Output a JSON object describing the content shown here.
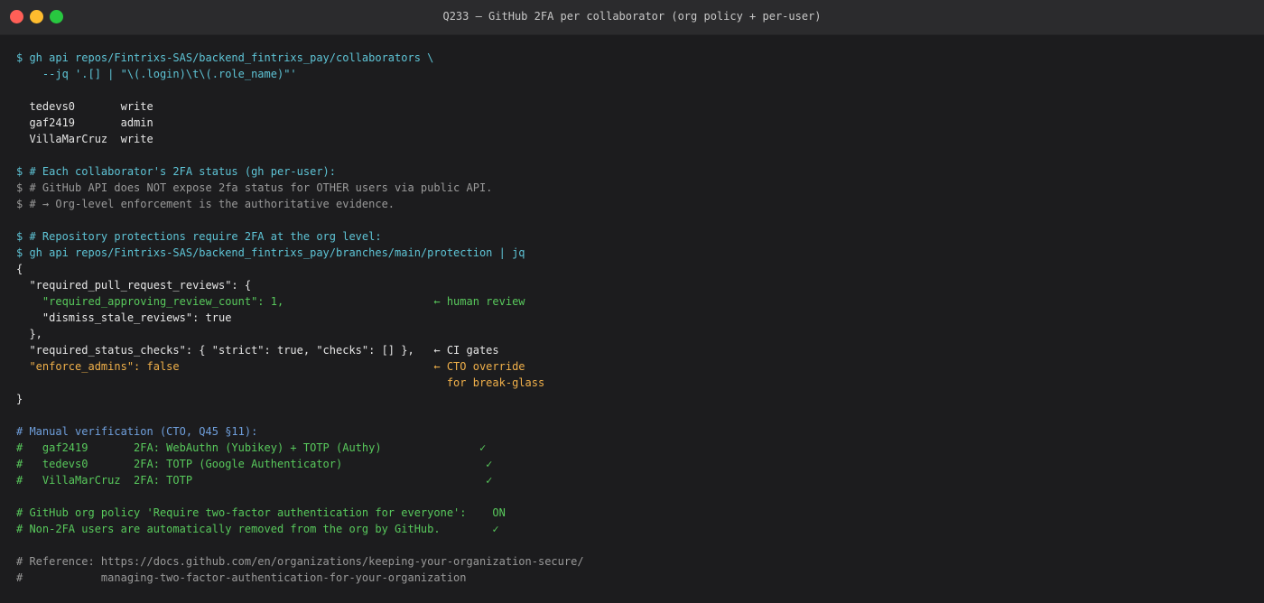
{
  "window": {
    "title": "Q233 — GitHub 2FA per collaborator (org policy + per-user)"
  },
  "terminal": {
    "lines": [
      {
        "text": "$ gh api repos/Fintrixs-SAS/backend_fintrixs_pay/collaborators \\",
        "color": "cyan"
      },
      {
        "text": "    --jq '.[] | \"\\(.login)\\t\\(.role_name)\"'",
        "color": "cyan"
      },
      {
        "text": "",
        "color": "white"
      },
      {
        "text": "  tedevs0       write",
        "color": "white"
      },
      {
        "text": "  gaf2419       admin",
        "color": "white"
      },
      {
        "text": "  VillaMarCruz  write",
        "color": "white"
      },
      {
        "text": "",
        "color": "white"
      },
      {
        "text": "$ # Each collaborator's 2FA status (gh per-user):",
        "color": "cyan"
      },
      {
        "text": "$ # GitHub API does NOT expose 2fa status for OTHER users via public API.",
        "color": "gray"
      },
      {
        "text": "$ # → Org-level enforcement is the authoritative evidence.",
        "color": "gray"
      },
      {
        "text": "",
        "color": "white"
      },
      {
        "text": "$ # Repository protections require 2FA at the org level:",
        "color": "cyan"
      },
      {
        "text": "$ gh api repos/Fintrixs-SAS/backend_fintrixs_pay/branches/main/protection | jq",
        "color": "cyan"
      },
      {
        "text": "{",
        "color": "white"
      },
      {
        "text": "  \"required_pull_request_reviews\": {",
        "color": "white"
      },
      {
        "text": "    \"required_approving_review_count\": 1,                       ← human review",
        "color": "green"
      },
      {
        "text": "    \"dismiss_stale_reviews\": true",
        "color": "white"
      },
      {
        "text": "  },",
        "color": "white"
      },
      {
        "text": "  \"required_status_checks\": { \"strict\": true, \"checks\": [] },   ← CI gates",
        "color": "white"
      },
      {
        "text": "  \"enforce_admins\": false                                       ← CTO override",
        "color": "orange"
      },
      {
        "text": "                                                                  for break-glass",
        "color": "orange"
      },
      {
        "text": "}",
        "color": "white"
      },
      {
        "text": "",
        "color": "white"
      },
      {
        "text": "# Manual verification (CTO, Q45 §11):",
        "color": "blue"
      },
      {
        "text": "#   gaf2419       2FA: WebAuthn (Yubikey) + TOTP (Authy)               ✓",
        "color": "green"
      },
      {
        "text": "#   tedevs0       2FA: TOTP (Google Authenticator)                      ✓",
        "color": "green"
      },
      {
        "text": "#   VillaMarCruz  2FA: TOTP                                             ✓",
        "color": "green"
      },
      {
        "text": "",
        "color": "white"
      },
      {
        "text": "# GitHub org policy 'Require two-factor authentication for everyone':    ON",
        "color": "green"
      },
      {
        "text": "# Non-2FA users are automatically removed from the org by GitHub.        ✓",
        "color": "green"
      },
      {
        "text": "",
        "color": "white"
      },
      {
        "text": "# Reference: https://docs.github.com/en/organizations/keeping-your-organization-secure/",
        "color": "gray"
      },
      {
        "text": "#            managing-two-factor-authentication-for-your-organization",
        "color": "gray"
      }
    ]
  }
}
